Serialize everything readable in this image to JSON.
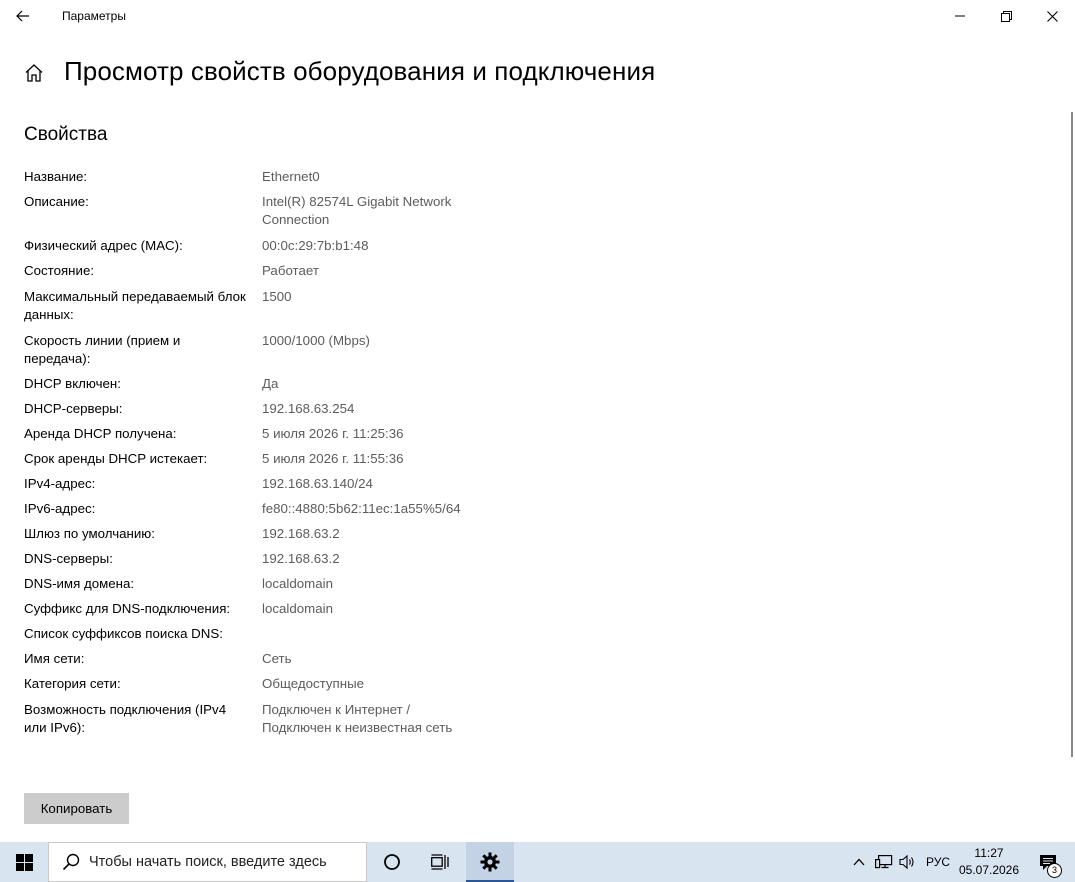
{
  "window": {
    "title": "Параметры",
    "back_icon": "arrow-left-icon",
    "minimize_icon": "minimize-icon",
    "maximize_icon": "restore-icon",
    "close_icon": "close-icon"
  },
  "header": {
    "home_icon": "home-icon",
    "title": "Просмотр свойств оборудования и подключения"
  },
  "section": {
    "title": "Свойства"
  },
  "properties": [
    {
      "label": "Название:",
      "value": "Ethernet0"
    },
    {
      "label": "Описание:",
      "value": "Intel(R) 82574L Gigabit Network Connection"
    },
    {
      "label": "Физический адрес (MAC):",
      "value": "00:0c:29:7b:b1:48"
    },
    {
      "label": "Состояние:",
      "value": "Работает"
    },
    {
      "label": "Максимальный передаваемый блок данных:",
      "value": "1500"
    },
    {
      "label": "Скорость линии (прием и передача):",
      "value": "1000/1000 (Mbps)"
    },
    {
      "label": "DHCP включен:",
      "value": "Да"
    },
    {
      "label": "DHCP-серверы:",
      "value": "192.168.63.254"
    },
    {
      "label": "Аренда DHCP получена:",
      "value": "5 июля 2026 г. 11:25:36"
    },
    {
      "label": "Срок аренды DHCP истекает:",
      "value": "5 июля 2026 г. 11:55:36"
    },
    {
      "label": "IPv4-адрес:",
      "value": "192.168.63.140/24"
    },
    {
      "label": "IPv6-адрес:",
      "value": "fe80::4880:5b62:11ec:1a55%5/64"
    },
    {
      "label": "Шлюз по умолчанию:",
      "value": "192.168.63.2"
    },
    {
      "label": "DNS-серверы:",
      "value": "192.168.63.2"
    },
    {
      "label": "DNS-имя домена:",
      "value": "localdomain"
    },
    {
      "label": "Суффикс для DNS-подключения:",
      "value": "localdomain"
    },
    {
      "label": "Список суффиксов поиска DNS:",
      "value": ""
    },
    {
      "label": "Имя сети:",
      "value": "Сеть"
    },
    {
      "label": "Категория сети:",
      "value": "Общедоступные"
    },
    {
      "label": "Возможность подключения (IPv4 или IPv6):",
      "value": "Подключен к Интернет / Подключен к неизвестная сеть"
    }
  ],
  "actions": {
    "copy_label": "Копировать"
  },
  "taskbar": {
    "start_icon": "windows-logo-icon",
    "search_icon": "search-icon",
    "search_placeholder": "Чтобы начать поиск, введите здесь",
    "cortana_icon": "cortana-circle-icon",
    "task_view_icon": "task-view-icon",
    "settings_icon": "gear-icon",
    "tray_chevron_icon": "chevron-up-icon",
    "network_icon": "network-icon",
    "volume_icon": "volume-icon",
    "language": "РУС",
    "time": "11:27",
    "date": "05.07.2026",
    "notification_icon": "action-center-icon",
    "notification_count": "3"
  }
}
